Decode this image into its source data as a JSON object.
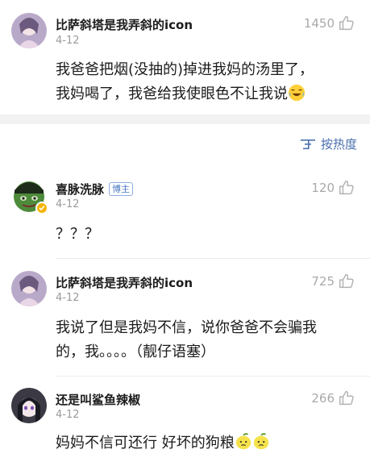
{
  "comments": [
    {
      "user": "比萨斜塔是我弄斜的icon",
      "date": "4-12",
      "likes": "1450",
      "text_line1": "我爸爸把烟(没抽的)掉进我妈的汤里了，",
      "text_line2": "我妈喝了，我爸给我使眼色不让我说",
      "emoji": "crying-laughing-emoji"
    },
    {
      "user": "喜脉洗脉",
      "badge": "博主",
      "date": "4-12",
      "likes": "120",
      "text_line1": "？？？"
    },
    {
      "user": "比萨斜塔是我弄斜的icon",
      "date": "4-12",
      "likes": "725",
      "text_line1": "我说了但是我妈不信，说你爸爸不会骗我",
      "text_line2": "的，我。。。。（靓仔语塞）"
    },
    {
      "user": "还是叫鲨鱼辣椒",
      "date": "4-12",
      "likes": "266",
      "text_line1": "妈妈不信可还行 好坏的狗粮",
      "emoji": "lemon-emoji"
    }
  ],
  "sort": {
    "label": "按热度",
    "icon": "sort-icon",
    "color": "#4a6fae"
  },
  "colors": {
    "text": "#1b1b1b",
    "meta": "#9a9a9a",
    "accent": "#4a6fae",
    "divider": "#f2f2f2"
  }
}
